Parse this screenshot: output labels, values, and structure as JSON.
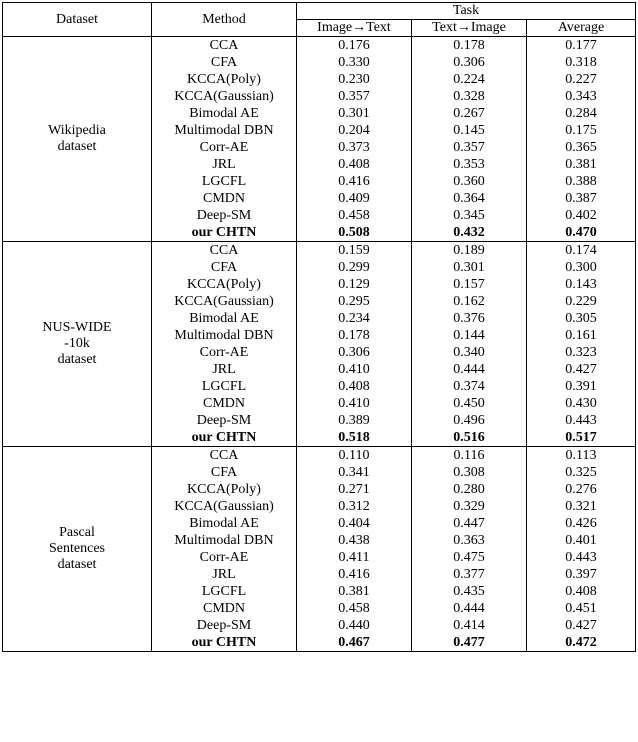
{
  "headers": {
    "dataset": "Dataset",
    "method": "Method",
    "task": "Task",
    "img2txt": "Image→Text",
    "txt2img": "Text→Image",
    "average": "Average"
  },
  "chart_data": {
    "type": "table",
    "title": "",
    "groups": [
      {
        "dataset": [
          "Wikipedia",
          "dataset"
        ],
        "rows": [
          {
            "method": "CCA",
            "i2t": "0.176",
            "t2i": "0.178",
            "avg": "0.177",
            "bold": false
          },
          {
            "method": "CFA",
            "i2t": "0.330",
            "t2i": "0.306",
            "avg": "0.318",
            "bold": false
          },
          {
            "method": "KCCA(Poly)",
            "i2t": "0.230",
            "t2i": "0.224",
            "avg": "0.227",
            "bold": false
          },
          {
            "method": "KCCA(Gaussian)",
            "i2t": "0.357",
            "t2i": "0.328",
            "avg": "0.343",
            "bold": false
          },
          {
            "method": "Bimodal AE",
            "i2t": "0.301",
            "t2i": "0.267",
            "avg": "0.284",
            "bold": false
          },
          {
            "method": "Multimodal DBN",
            "i2t": "0.204",
            "t2i": "0.145",
            "avg": "0.175",
            "bold": false
          },
          {
            "method": "Corr-AE",
            "i2t": "0.373",
            "t2i": "0.357",
            "avg": "0.365",
            "bold": false
          },
          {
            "method": "JRL",
            "i2t": "0.408",
            "t2i": "0.353",
            "avg": "0.381",
            "bold": false
          },
          {
            "method": "LGCFL",
            "i2t": "0.416",
            "t2i": "0.360",
            "avg": "0.388",
            "bold": false
          },
          {
            "method": "CMDN",
            "i2t": "0.409",
            "t2i": "0.364",
            "avg": "0.387",
            "bold": false
          },
          {
            "method": "Deep-SM",
            "i2t": "0.458",
            "t2i": "0.345",
            "avg": "0.402",
            "bold": false
          },
          {
            "method": "our CHTN",
            "i2t": "0.508",
            "t2i": "0.432",
            "avg": "0.470",
            "bold": true
          }
        ]
      },
      {
        "dataset": [
          "NUS-WIDE",
          "-10k",
          "dataset"
        ],
        "rows": [
          {
            "method": "CCA",
            "i2t": "0.159",
            "t2i": "0.189",
            "avg": "0.174",
            "bold": false
          },
          {
            "method": "CFA",
            "i2t": "0.299",
            "t2i": "0.301",
            "avg": "0.300",
            "bold": false
          },
          {
            "method": "KCCA(Poly)",
            "i2t": "0.129",
            "t2i": "0.157",
            "avg": "0.143",
            "bold": false
          },
          {
            "method": "KCCA(Gaussian)",
            "i2t": "0.295",
            "t2i": "0.162",
            "avg": "0.229",
            "bold": false
          },
          {
            "method": "Bimodal AE",
            "i2t": "0.234",
            "t2i": "0.376",
            "avg": "0.305",
            "bold": false
          },
          {
            "method": "Multimodal DBN",
            "i2t": "0.178",
            "t2i": "0.144",
            "avg": "0.161",
            "bold": false
          },
          {
            "method": "Corr-AE",
            "i2t": "0.306",
            "t2i": "0.340",
            "avg": "0.323",
            "bold": false
          },
          {
            "method": "JRL",
            "i2t": "0.410",
            "t2i": "0.444",
            "avg": "0.427",
            "bold": false
          },
          {
            "method": "LGCFL",
            "i2t": "0.408",
            "t2i": "0.374",
            "avg": "0.391",
            "bold": false
          },
          {
            "method": "CMDN",
            "i2t": "0.410",
            "t2i": "0.450",
            "avg": "0.430",
            "bold": false
          },
          {
            "method": "Deep-SM",
            "i2t": "0.389",
            "t2i": "0.496",
            "avg": "0.443",
            "bold": false
          },
          {
            "method": "our CHTN",
            "i2t": "0.518",
            "t2i": "0.516",
            "avg": "0.517",
            "bold": true
          }
        ]
      },
      {
        "dataset": [
          "Pascal",
          "Sentences",
          "dataset"
        ],
        "rows": [
          {
            "method": "CCA",
            "i2t": "0.110",
            "t2i": "0.116",
            "avg": "0.113",
            "bold": false
          },
          {
            "method": "CFA",
            "i2t": "0.341",
            "t2i": "0.308",
            "avg": "0.325",
            "bold": false
          },
          {
            "method": "KCCA(Poly)",
            "i2t": "0.271",
            "t2i": "0.280",
            "avg": "0.276",
            "bold": false
          },
          {
            "method": "KCCA(Gaussian)",
            "i2t": "0.312",
            "t2i": "0.329",
            "avg": "0.321",
            "bold": false
          },
          {
            "method": "Bimodal AE",
            "i2t": "0.404",
            "t2i": "0.447",
            "avg": "0.426",
            "bold": false
          },
          {
            "method": "Multimodal DBN",
            "i2t": "0.438",
            "t2i": "0.363",
            "avg": "0.401",
            "bold": false
          },
          {
            "method": "Corr-AE",
            "i2t": "0.411",
            "t2i": "0.475",
            "avg": "0.443",
            "bold": false
          },
          {
            "method": "JRL",
            "i2t": "0.416",
            "t2i": "0.377",
            "avg": "0.397",
            "bold": false
          },
          {
            "method": "LGCFL",
            "i2t": "0.381",
            "t2i": "0.435",
            "avg": "0.408",
            "bold": false
          },
          {
            "method": "CMDN",
            "i2t": "0.458",
            "t2i": "0.444",
            "avg": "0.451",
            "bold": false
          },
          {
            "method": "Deep-SM",
            "i2t": "0.440",
            "t2i": "0.414",
            "avg": "0.427",
            "bold": false
          },
          {
            "method": "our CHTN",
            "i2t": "0.467",
            "t2i": "0.477",
            "avg": "0.472",
            "bold": true
          }
        ]
      }
    ]
  }
}
